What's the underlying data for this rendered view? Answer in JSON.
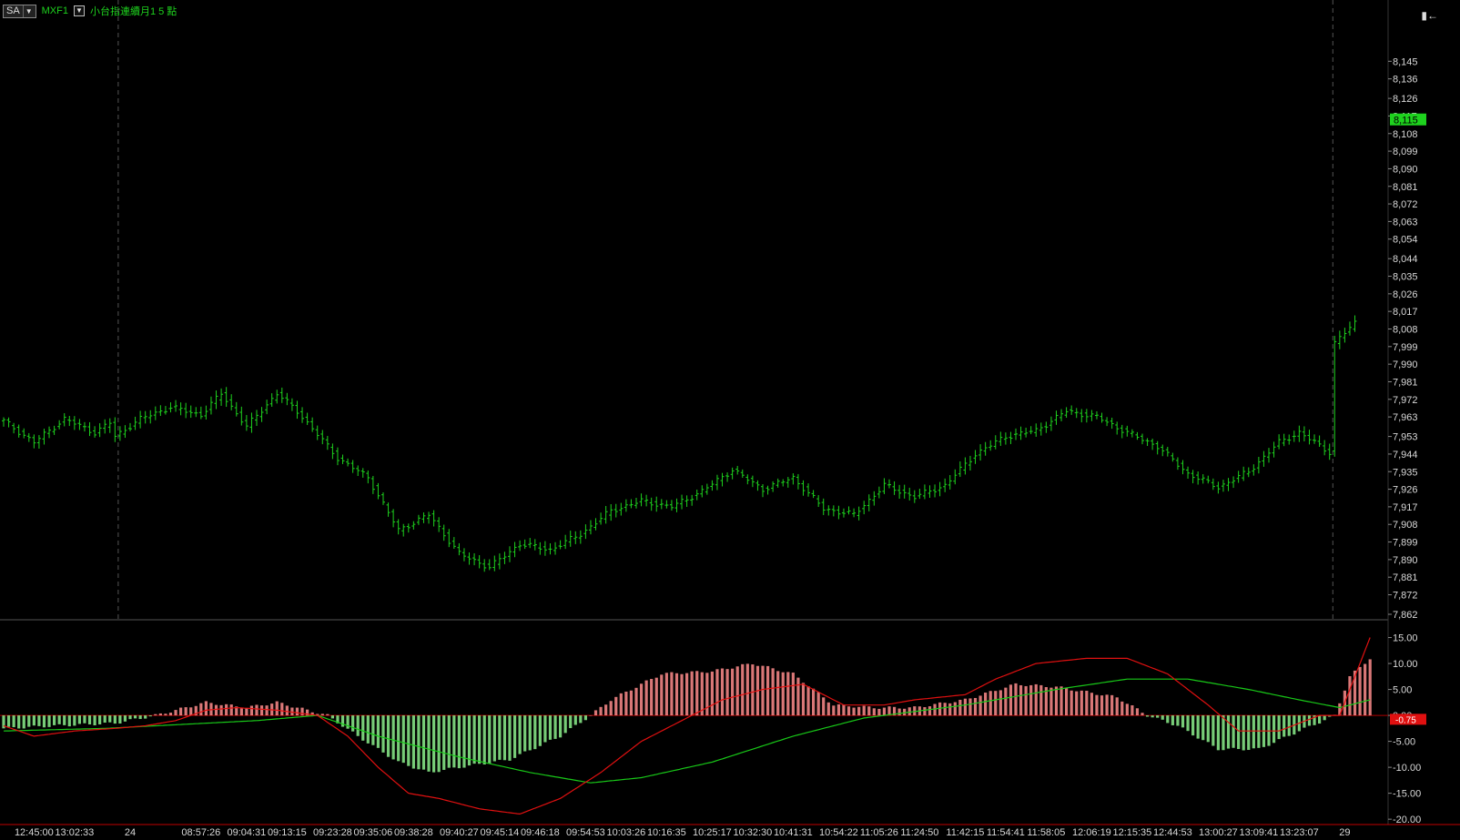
{
  "header": {
    "sa_label": "SA",
    "symbol": "MXF1",
    "title": "小台指連續月1 5 點",
    "corner_icon": "pin-arrow-left-icon"
  },
  "colors": {
    "background": "#000000",
    "price_bars": "#1ed21e",
    "price_tag": "#1ed21e",
    "hist_positive": "#ff8c8c",
    "hist_negative": "#8cf08c",
    "macd_line": "#e01010",
    "signal_line": "#18c818",
    "axis_text": "#d8d8d8",
    "session_divider": "#555555",
    "panel_divider": "#555555",
    "axis_line": "#c00000"
  },
  "chart_data": [
    {
      "type": "ohlc",
      "panel": "price",
      "title": "",
      "ylim": [
        7862,
        8154
      ],
      "yticks": [
        "8,145",
        "8,136",
        "8,126",
        "8,117",
        "8,108",
        "8,099",
        "8,090",
        "8,081",
        "8,072",
        "8,063",
        "8,054",
        "8,044",
        "8,035",
        "8,026",
        "8,017",
        "8,008",
        "7,999",
        "7,990",
        "7,981",
        "7,972",
        "7,963",
        "7,953",
        "7,944",
        "7,935",
        "7,926",
        "7,917",
        "7,908",
        "7,899",
        "7,890",
        "7,881",
        "7,872",
        "7,862"
      ],
      "ytick_values": [
        8145,
        8136,
        8126,
        8117,
        8108,
        8099,
        8090,
        8081,
        8072,
        8063,
        8054,
        8044,
        8035,
        8026,
        8017,
        8008,
        7999,
        7990,
        7981,
        7972,
        7963,
        7953,
        7944,
        7935,
        7926,
        7917,
        7908,
        7899,
        7890,
        7881,
        7872,
        7862
      ],
      "last_price_label": "8,115",
      "last_price": 8115,
      "anchors": [
        [
          0,
          7961
        ],
        [
          6,
          7950
        ],
        [
          12,
          7962
        ],
        [
          18,
          7955
        ],
        [
          21,
          7960
        ],
        [
          22,
          7953
        ],
        [
          27,
          7962
        ],
        [
          33,
          7968
        ],
        [
          39,
          7964
        ],
        [
          43,
          7975
        ],
        [
          48,
          7958
        ],
        [
          54,
          7975
        ],
        [
          58,
          7966
        ],
        [
          66,
          7942
        ],
        [
          72,
          7932
        ],
        [
          78,
          7905
        ],
        [
          84,
          7913
        ],
        [
          90,
          7893
        ],
        [
          96,
          7886
        ],
        [
          102,
          7898
        ],
        [
          108,
          7895
        ],
        [
          114,
          7903
        ],
        [
          120,
          7915
        ],
        [
          126,
          7920
        ],
        [
          132,
          7917
        ],
        [
          138,
          7925
        ],
        [
          144,
          7936
        ],
        [
          150,
          7926
        ],
        [
          156,
          7932
        ],
        [
          162,
          7916
        ],
        [
          168,
          7913
        ],
        [
          174,
          7928
        ],
        [
          180,
          7922
        ],
        [
          186,
          7928
        ],
        [
          192,
          7944
        ],
        [
          198,
          7953
        ],
        [
          204,
          7956
        ],
        [
          210,
          7966
        ],
        [
          216,
          7963
        ],
        [
          222,
          7955
        ],
        [
          228,
          7948
        ],
        [
          234,
          7934
        ],
        [
          240,
          7927
        ],
        [
          246,
          7935
        ],
        [
          252,
          7950
        ],
        [
          256,
          7955
        ],
        [
          262,
          7945
        ],
        [
          263,
          8001
        ],
        [
          267,
          8011
        ]
      ],
      "amplitude": 3,
      "x_tick_labels": [
        "12:45:00",
        "13:02:33",
        "24",
        "08:57:26",
        "09:04:31",
        "09:13:15",
        "09:23:28",
        "09:35:06",
        "09:38:28",
        "09:40:27",
        "09:45:14",
        "09:46:18",
        "09:54:53",
        "10:03:26",
        "10:16:35",
        "10:25:17",
        "10:32:30",
        "10:41:31",
        "10:54:22",
        "11:05:26",
        "11:24:50",
        "11:42:15",
        "11:54:41",
        "11:58:05",
        "12:06:19",
        "12:15:35",
        "12:44:53",
        "13:00:27",
        "13:09:41",
        "13:23:07",
        "29"
      ],
      "x_tick_index": [
        6,
        14,
        25,
        39,
        48,
        56,
        65,
        73,
        81,
        90,
        98,
        106,
        115,
        123,
        131,
        140,
        148,
        156,
        165,
        173,
        181,
        190,
        198,
        206,
        215,
        223,
        231,
        240,
        248,
        256,
        265
      ],
      "session_breaks": [
        23,
        263
      ]
    },
    {
      "type": "macd",
      "panel": "indicator",
      "title": "",
      "ylim": [
        -20.5,
        17.2
      ],
      "yticks": [
        "15.00",
        "10.00",
        "5.00",
        "0.00",
        "-5.00",
        "-10.00",
        "-15.00",
        "-20.00"
      ],
      "ytick_values": [
        15,
        10,
        5,
        0,
        -5,
        -10,
        -15,
        -20
      ],
      "last_value_label": "-0.75",
      "last_value": -0.75,
      "histogram_anchors": [
        [
          0,
          -2.5
        ],
        [
          10,
          -2
        ],
        [
          22,
          -1.5
        ],
        [
          30,
          0
        ],
        [
          40,
          2.5
        ],
        [
          48,
          1.5
        ],
        [
          54,
          2.5
        ],
        [
          62,
          0.5
        ],
        [
          64,
          0
        ],
        [
          70,
          -4
        ],
        [
          78,
          -9
        ],
        [
          84,
          -11
        ],
        [
          90,
          -10
        ],
        [
          100,
          -8.5
        ],
        [
          110,
          -4
        ],
        [
          116,
          0
        ],
        [
          120,
          3
        ],
        [
          130,
          8
        ],
        [
          140,
          8.5
        ],
        [
          148,
          10
        ],
        [
          156,
          8
        ],
        [
          164,
          2
        ],
        [
          172,
          1.5
        ],
        [
          180,
          1.5
        ],
        [
          190,
          3
        ],
        [
          200,
          6
        ],
        [
          208,
          5.5
        ],
        [
          220,
          3.5
        ],
        [
          226,
          0
        ],
        [
          232,
          -2
        ],
        [
          240,
          -6.5
        ],
        [
          248,
          -6.5
        ],
        [
          256,
          -3
        ],
        [
          262,
          -0.5
        ],
        [
          263,
          0
        ],
        [
          266,
          7.5
        ],
        [
          270,
          11
        ]
      ],
      "macd_anchors": [
        [
          0,
          -2
        ],
        [
          6,
          -4
        ],
        [
          14,
          -3
        ],
        [
          22,
          -2.5
        ],
        [
          28,
          -2
        ],
        [
          34,
          -1
        ],
        [
          40,
          1
        ],
        [
          46,
          1.5
        ],
        [
          54,
          1
        ],
        [
          62,
          0
        ],
        [
          68,
          -4
        ],
        [
          74,
          -10
        ],
        [
          80,
          -15
        ],
        [
          86,
          -16
        ],
        [
          94,
          -18
        ],
        [
          102,
          -19
        ],
        [
          110,
          -16
        ],
        [
          118,
          -11
        ],
        [
          126,
          -5
        ],
        [
          134,
          -1
        ],
        [
          142,
          3
        ],
        [
          150,
          5
        ],
        [
          158,
          6
        ],
        [
          166,
          2
        ],
        [
          174,
          2
        ],
        [
          180,
          3
        ],
        [
          190,
          4
        ],
        [
          196,
          7
        ],
        [
          204,
          10
        ],
        [
          214,
          11
        ],
        [
          222,
          11
        ],
        [
          230,
          8
        ],
        [
          238,
          2
        ],
        [
          244,
          -3
        ],
        [
          252,
          -3
        ],
        [
          260,
          0
        ],
        [
          264,
          0
        ],
        [
          270,
          15
        ]
      ],
      "signal_anchors": [
        [
          0,
          -3
        ],
        [
          20,
          -2.5
        ],
        [
          30,
          -2
        ],
        [
          50,
          -1
        ],
        [
          62,
          0
        ],
        [
          74,
          -4
        ],
        [
          90,
          -8
        ],
        [
          104,
          -11
        ],
        [
          116,
          -13
        ],
        [
          126,
          -12
        ],
        [
          140,
          -9
        ],
        [
          156,
          -4
        ],
        [
          170,
          -0.5
        ],
        [
          190,
          2
        ],
        [
          208,
          5
        ],
        [
          222,
          7
        ],
        [
          234,
          7
        ],
        [
          246,
          5
        ],
        [
          256,
          3
        ],
        [
          264,
          1.5
        ],
        [
          270,
          3
        ]
      ]
    }
  ]
}
